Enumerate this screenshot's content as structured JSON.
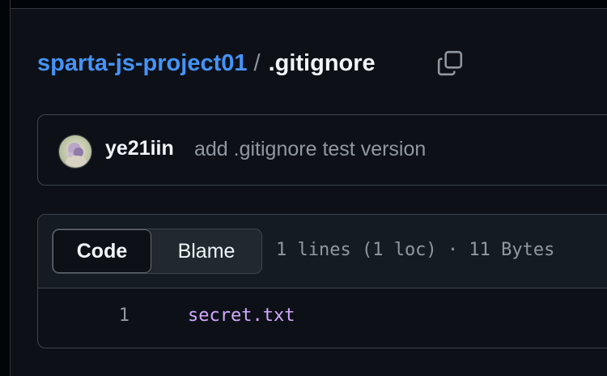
{
  "breadcrumb": {
    "repo": "sparta-js-project01",
    "separator": "/",
    "file": ".gitignore"
  },
  "icons": {
    "copy": "copy-icon",
    "avatar": "user-avatar"
  },
  "commit": {
    "author": "ye21iin",
    "message": "add .gitignore test version"
  },
  "file_view": {
    "tabs": [
      {
        "label": "Code",
        "selected": true
      },
      {
        "label": "Blame",
        "selected": false
      }
    ],
    "meta": "1 lines (1 loc) · 11 Bytes",
    "lines": [
      {
        "number": "1",
        "text": "secret.txt"
      }
    ]
  },
  "colors": {
    "background": "#0d1117",
    "link": "#4493f8",
    "border": "#3d444d",
    "muted": "#9198a1",
    "code_text": "#d2a8ff"
  }
}
